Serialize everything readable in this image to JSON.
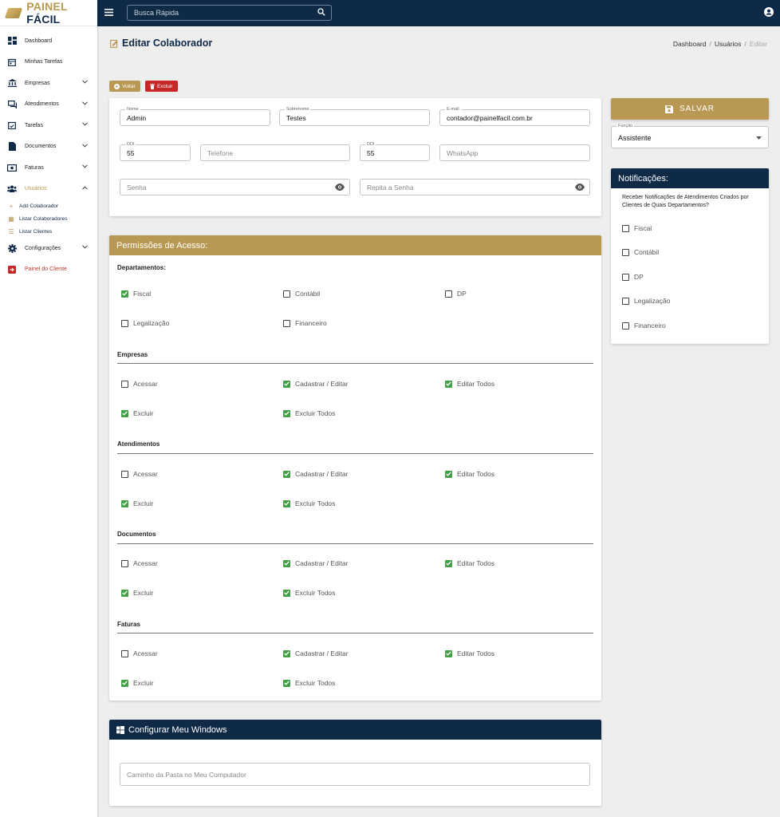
{
  "brand": {
    "part1": "PAINEL",
    "part2": "FÁCIL"
  },
  "search": {
    "placeholder": "Busca Rápida"
  },
  "sidebar": {
    "items": [
      {
        "label": "Dashboard"
      },
      {
        "label": "Minhas Tarefas"
      },
      {
        "label": "Empresas"
      },
      {
        "label": "Atendimentos"
      },
      {
        "label": "Tarefas"
      },
      {
        "label": "Documentos"
      },
      {
        "label": "Faturas"
      },
      {
        "label": "Usuários"
      },
      {
        "label": "Configurações"
      },
      {
        "label": "Painel do Cliente"
      }
    ],
    "sub": [
      {
        "label": "Add Colaborador"
      },
      {
        "label": "Listar Colaboradores"
      },
      {
        "label": "Listar Clientes"
      }
    ]
  },
  "page": {
    "title": "Editar Colaborador"
  },
  "breadcrumb": {
    "a": "Dashboard",
    "b": "Usuários",
    "c": "Editar",
    "sep": "/"
  },
  "actions": {
    "back": "Voltar",
    "delete": "Excluir",
    "save": "SALVAR"
  },
  "form": {
    "nome": {
      "label": "Nome",
      "value": "Admin"
    },
    "sobrenome": {
      "label": "Sobrenome",
      "value": "Testes"
    },
    "email": {
      "label": "E-mail",
      "value": "contador@painelfacil.com.br"
    },
    "ddi1": {
      "label": "DDI",
      "value": "55"
    },
    "telefone": {
      "placeholder": "Telefone"
    },
    "ddi2": {
      "label": "DDI",
      "value": "55"
    },
    "whatsapp": {
      "placeholder": "WhatsApp"
    },
    "senha": {
      "placeholder": "Senha"
    },
    "repita": {
      "placeholder": "Repita a Senha"
    }
  },
  "funcao": {
    "label": "Função",
    "value": "Assistente"
  },
  "permissions": {
    "title": "Permissões de Acesso:",
    "departamentos": {
      "title": "Departamentos:",
      "items": [
        "Fiscal",
        "Contábil",
        "DP",
        "Legalização",
        "Financeiro"
      ]
    },
    "empresas": {
      "title": "Empresas"
    },
    "atendimentos": {
      "title": "Atendimentos"
    },
    "documentos": {
      "title": "Documentos"
    },
    "faturas": {
      "title": "Faturas"
    },
    "labels": {
      "acessar": "Acessar",
      "cadastrar": "Cadastrar / Editar",
      "editar_todos": "Editar Todos",
      "excluir": "Excluir",
      "excluir_todos": "Excluir Todos"
    }
  },
  "notificacoes": {
    "title": "Notificações:",
    "text": "Receber Notificações de Atendimentos Criados por Clientes de Quais Departamentos?",
    "items": [
      "Fiscal",
      "Contábil",
      "DP",
      "Legalização",
      "Financeiro"
    ]
  },
  "windows": {
    "title": "Configurar Meu Windows",
    "placeholder": "Caminho da Pasta no Meu Computador"
  },
  "colors": {
    "navy": "#0e2a47",
    "gold": "#b99853",
    "green": "#43a047",
    "red": "#c62828"
  }
}
